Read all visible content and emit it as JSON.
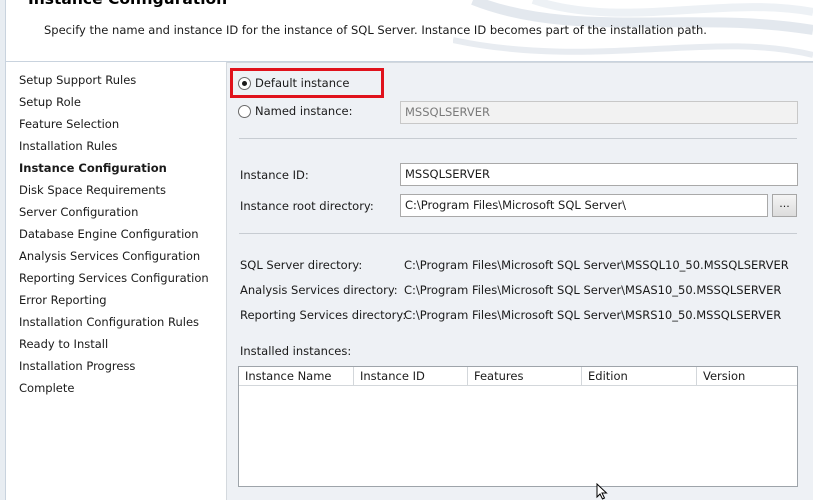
{
  "header": {
    "title": "Instance Configuration",
    "description": "Specify the name and instance ID for the instance of SQL Server. Instance ID becomes part of the installation path."
  },
  "nav": {
    "items": [
      {
        "label": "Setup Support Rules",
        "active": false
      },
      {
        "label": "Setup Role",
        "active": false
      },
      {
        "label": "Feature Selection",
        "active": false
      },
      {
        "label": "Installation Rules",
        "active": false
      },
      {
        "label": "Instance Configuration",
        "active": true
      },
      {
        "label": "Disk Space Requirements",
        "active": false
      },
      {
        "label": "Server Configuration",
        "active": false
      },
      {
        "label": "Database Engine Configuration",
        "active": false
      },
      {
        "label": "Analysis Services Configuration",
        "active": false
      },
      {
        "label": "Reporting Services Configuration",
        "active": false
      },
      {
        "label": "Error Reporting",
        "active": false
      },
      {
        "label": "Installation Configuration Rules",
        "active": false
      },
      {
        "label": "Ready to Install",
        "active": false
      },
      {
        "label": "Installation Progress",
        "active": false
      },
      {
        "label": "Complete",
        "active": false
      }
    ]
  },
  "instance": {
    "default_label": "Default instance",
    "named_label": "Named instance:",
    "named_value": "MSSQLSERVER",
    "selected": "default"
  },
  "fields": {
    "instance_id_label": "Instance ID:",
    "instance_id_value": "MSSQLSERVER",
    "root_dir_label": "Instance root directory:",
    "root_dir_value": "C:\\Program Files\\Microsoft SQL Server\\",
    "browse_label": "..."
  },
  "directories": {
    "sql_label": "SQL Server directory:",
    "sql_value": "C:\\Program Files\\Microsoft SQL Server\\MSSQL10_50.MSSQLSERVER",
    "as_label": "Analysis Services directory:",
    "as_value": "C:\\Program Files\\Microsoft SQL Server\\MSAS10_50.MSSQLSERVER",
    "rs_label": "Reporting Services directory:",
    "rs_value": "C:\\Program Files\\Microsoft SQL Server\\MSRS10_50.MSSQLSERVER"
  },
  "installed": {
    "label": "Installed instances:",
    "columns": [
      "Instance Name",
      "Instance ID",
      "Features",
      "Edition",
      "Version"
    ],
    "rows": []
  },
  "colors": {
    "highlight": "#e0121c",
    "content_bg": "#eef1f5"
  },
  "icons": {
    "cursor": "mouse-pointer-icon"
  }
}
